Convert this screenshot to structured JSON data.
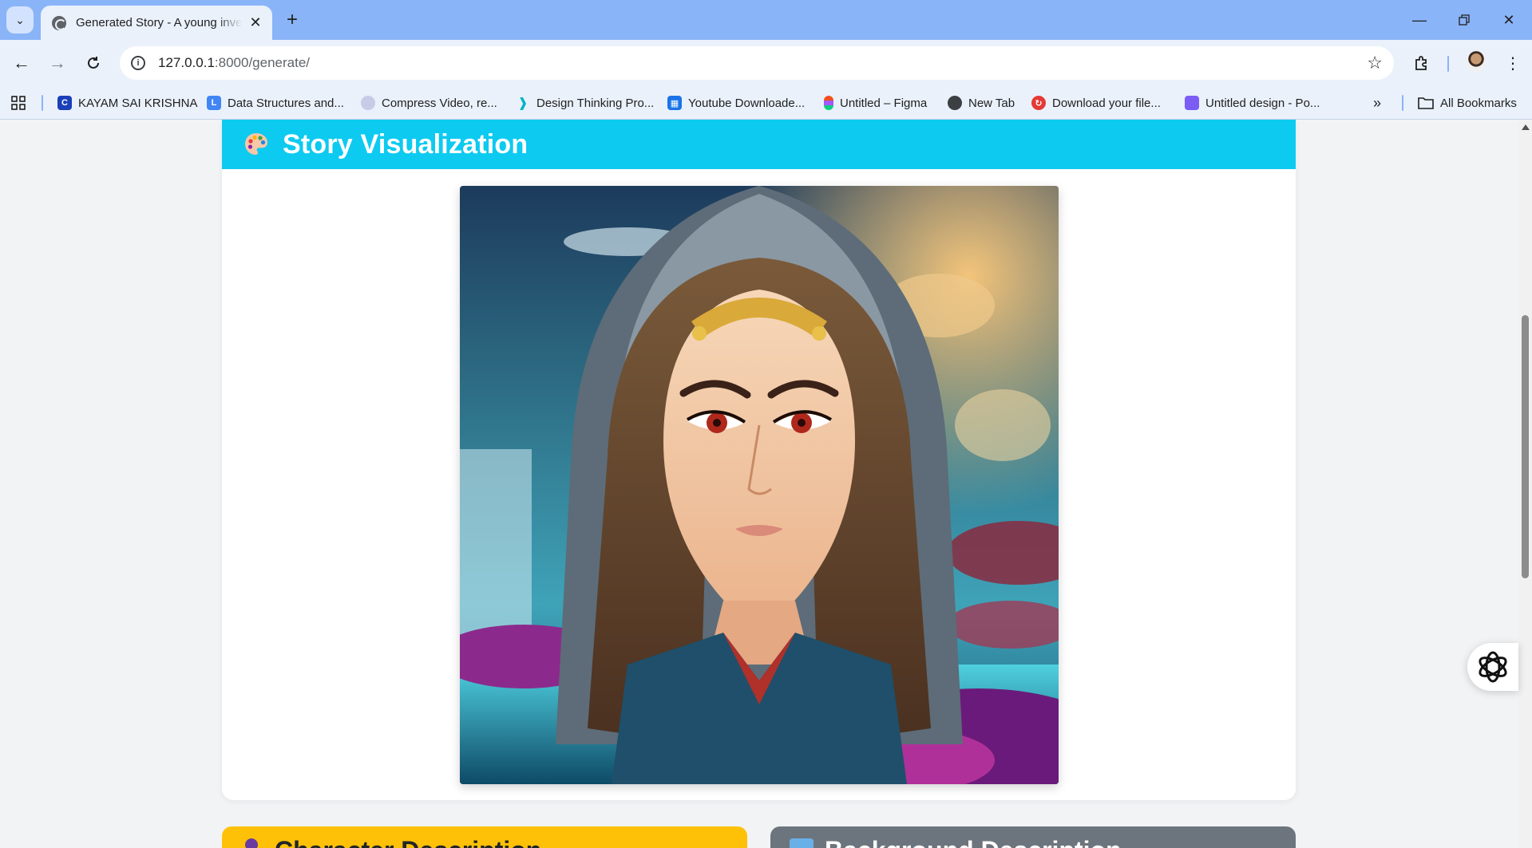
{
  "browser": {
    "tab_title": "Generated Story - A young inve",
    "url_host": "127.0.0.1",
    "url_path": ":8000/generate/",
    "bookmarks": [
      {
        "label": "KAYAM SAI KRISHNA",
        "icon": "c-logo-icon",
        "color": "#1a3fb8"
      },
      {
        "label": "Data Structures and...",
        "icon": "bookmark-icon",
        "color": "#4285f4"
      },
      {
        "label": "Compress Video, re...",
        "icon": "compress-icon",
        "color": "#9aa0c8"
      },
      {
        "label": "Design Thinking Pro...",
        "icon": "design-icon",
        "color": "#00b3c7"
      },
      {
        "label": "Youtube Downloade...",
        "icon": "grid-app-icon",
        "color": "#1a73e8"
      },
      {
        "label": "Untitled – Figma",
        "icon": "figma-icon",
        "color": "#f24e1e"
      },
      {
        "label": "New Tab",
        "icon": "chrome-icon",
        "color": "#3c4043"
      },
      {
        "label": "Download your file...",
        "icon": "download-icon",
        "color": "#e53935"
      },
      {
        "label": "Untitled design - Po...",
        "icon": "canva-icon",
        "color": "#7b5cf5"
      }
    ],
    "all_bookmarks": "All Bookmarks"
  },
  "page": {
    "visualization": {
      "title": "Story Visualization",
      "header_color": "#0dcaf0",
      "image_alt": "anime-portrait-illustration"
    },
    "character": {
      "title": "Character Description",
      "header_color": "#ffc107"
    },
    "background": {
      "title": "Background Description",
      "header_color": "#6c757d"
    }
  }
}
